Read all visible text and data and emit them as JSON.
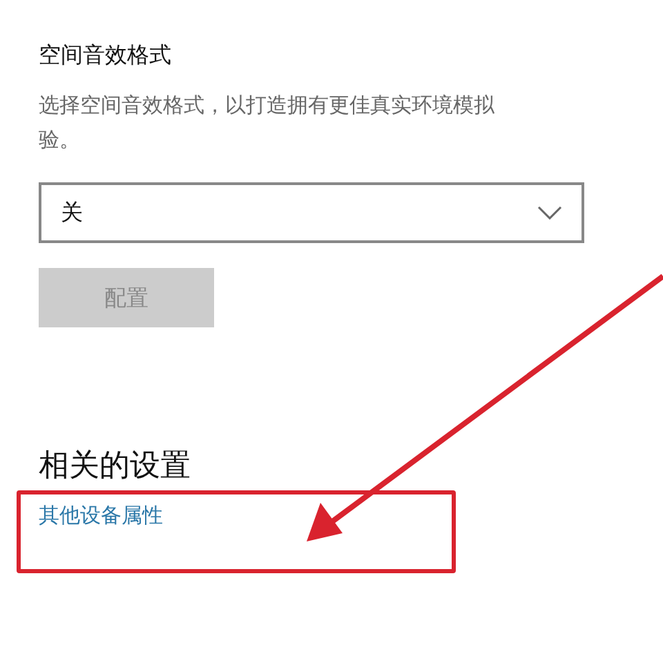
{
  "spatial_sound": {
    "title": "空间音效格式",
    "description_lines": [
      "选择空间音效格式，以打造拥有更佳真实环境模拟",
      "验。"
    ],
    "dropdown": {
      "value": "关"
    },
    "button": {
      "label": "配置",
      "disabled": true
    }
  },
  "related_settings": {
    "title": "相关的设置",
    "links": [
      "其他设备属性"
    ]
  },
  "annotations": {
    "highlight_box": true,
    "pointer_arrow": true
  }
}
